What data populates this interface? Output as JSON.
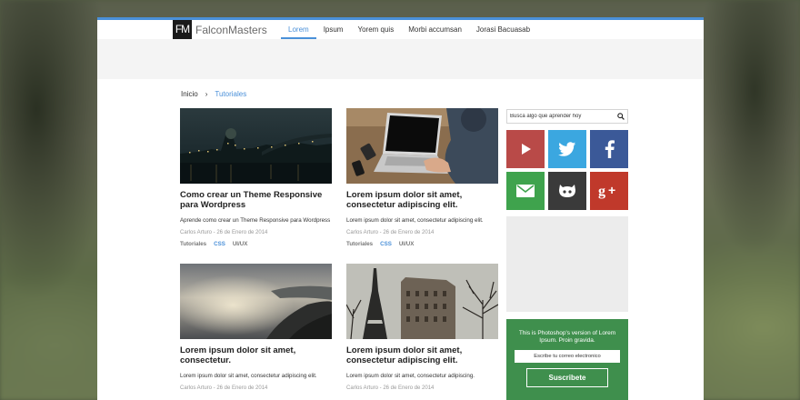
{
  "site": {
    "logo_mark": "FM",
    "logo_name": "FalconMasters"
  },
  "nav": {
    "items": [
      {
        "label": "Lorem",
        "active": true
      },
      {
        "label": "Ipsum",
        "active": false
      },
      {
        "label": "Yorem quis",
        "active": false
      },
      {
        "label": "Morbi accumsan",
        "active": false
      },
      {
        "label": "Jorasi Bacuasab",
        "active": false
      }
    ]
  },
  "breadcrumb": {
    "home": "Inicio",
    "separator": "›",
    "current": "Tutoriales"
  },
  "posts": [
    {
      "title": "Como crear un Theme Responsive para Wordpress",
      "excerpt": "Aprende como crear un Theme Responsive para Wordpress",
      "meta": "Carlos Arturo - 26 de Enero de 2014",
      "tags": [
        "Tutoriales",
        "CSS",
        "UI/UX"
      ]
    },
    {
      "title": "Lorem ipsum dolor sit amet, consectetur adipiscing elit.",
      "excerpt": "Lorem ipsum dolor sit amet, consectetur adipiscing elit.",
      "meta": "Carlos Arturo - 26 de Enero de 2014",
      "tags": [
        "Tutoriales",
        "CSS",
        "UI/UX"
      ]
    },
    {
      "title": "Lorem ipsum dolor sit amet, consectetur.",
      "excerpt": "Lorem ipsum dolor sit amet, consectetur adipiscing elit.",
      "meta": "Carlos Arturo - 26 de Enero de 2014",
      "tags": []
    },
    {
      "title": "Lorem ipsum dolor sit amet, consectetur adipiscing elit.",
      "excerpt": "Lorem ipsum dolor sit amet, consectetur adipiscing.",
      "meta": "Carlos Arturo - 26 de Enero de 2014",
      "tags": []
    }
  ],
  "search": {
    "placeholder": "Busca algo que aprender hoy",
    "icon": "search-icon"
  },
  "social": [
    {
      "name": "youtube",
      "icon": "play-icon",
      "color": "#b94a48"
    },
    {
      "name": "twitter",
      "icon": "twitter-icon",
      "color": "#3ba7e0"
    },
    {
      "name": "facebook",
      "icon": "facebook-icon",
      "color": "#3b5998"
    },
    {
      "name": "email",
      "icon": "mail-icon",
      "color": "#3fa34d"
    },
    {
      "name": "github",
      "icon": "github-icon",
      "color": "#3a3a3a"
    },
    {
      "name": "google-plus",
      "icon": "google-plus-icon",
      "color": "#c0392b"
    }
  ],
  "newsletter": {
    "text": "This is Photoshop's version  of Lorem Ipsum. Proin gravida.",
    "placeholder": "Escribe tu correo electronico",
    "button": "Suscribete",
    "color": "#3f8f4d"
  },
  "colors": {
    "accent": "#4a90d9"
  }
}
